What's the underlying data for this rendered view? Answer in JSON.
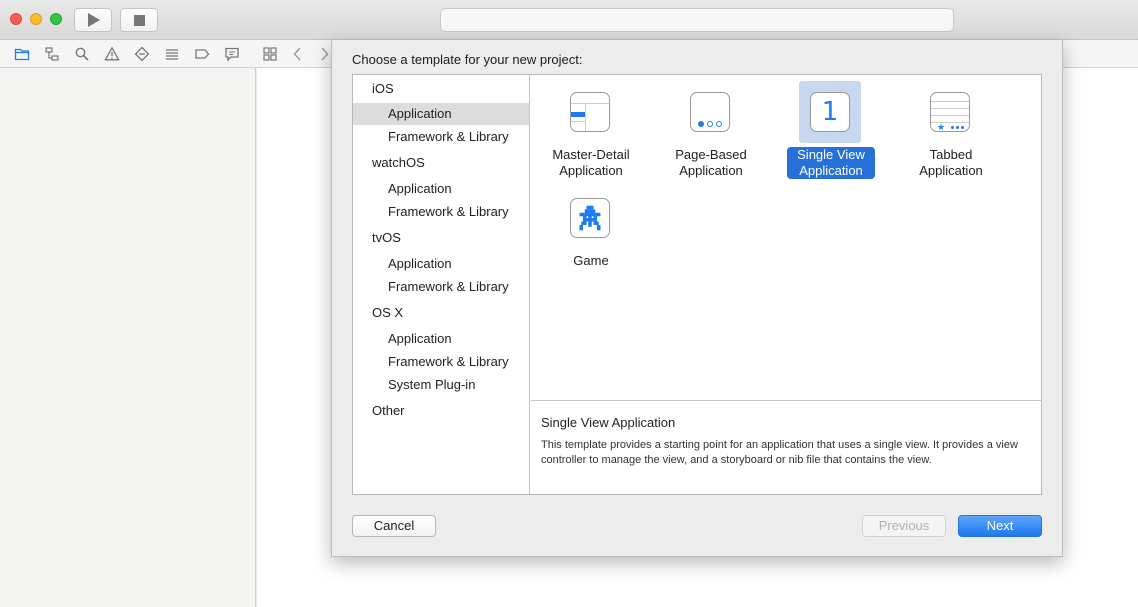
{
  "toolbar": {
    "run_icon": "play-icon",
    "stop_icon": "stop-icon",
    "activity_text": ""
  },
  "navigator_icons": [
    "folder-icon",
    "hierarchy-icon",
    "search-icon",
    "warning-icon",
    "test-diamond-icon",
    "debug-list-icon",
    "breakpoint-icon",
    "comment-icon"
  ],
  "editor_bar_icons": [
    "grid-icon",
    "back-chevron-icon",
    "forward-chevron-icon"
  ],
  "dialog": {
    "title": "Choose a template for your new project:",
    "categories": [
      {
        "name": "iOS",
        "items": [
          "Application",
          "Framework & Library"
        ]
      },
      {
        "name": "watchOS",
        "items": [
          "Application",
          "Framework & Library"
        ]
      },
      {
        "name": "tvOS",
        "items": [
          "Application",
          "Framework & Library"
        ]
      },
      {
        "name": "OS X",
        "items": [
          "Application",
          "Framework & Library",
          "System Plug-in"
        ]
      },
      {
        "name": "Other",
        "items": []
      }
    ],
    "selected_category": "iOS / Application",
    "templates": [
      {
        "line1": "Master-Detail",
        "line2": "Application",
        "icon": "master-detail-icon"
      },
      {
        "line1": "Page-Based",
        "line2": "Application",
        "icon": "page-based-icon"
      },
      {
        "line1": "Single View",
        "line2": "Application",
        "icon": "single-view-icon",
        "glyph": "1"
      },
      {
        "line1": "Tabbed",
        "line2": "Application",
        "icon": "tabbed-icon"
      },
      {
        "line1": "Game",
        "line2": "",
        "icon": "game-sprite-icon"
      }
    ],
    "selected_template": "Single View Application",
    "description": {
      "title": "Single View Application",
      "body": "This template provides a starting point for an application that uses a single view. It provides a view controller to manage the view, and a storyboard or nib file that contains the view."
    },
    "buttons": {
      "cancel": "Cancel",
      "previous": "Previous",
      "next": "Next"
    }
  },
  "colors": {
    "accent": "#2671d9",
    "selection_bg": "#c8d7ef",
    "category_selected_bg": "#dcdcdc",
    "icon_blue": "#1e7cf2"
  }
}
